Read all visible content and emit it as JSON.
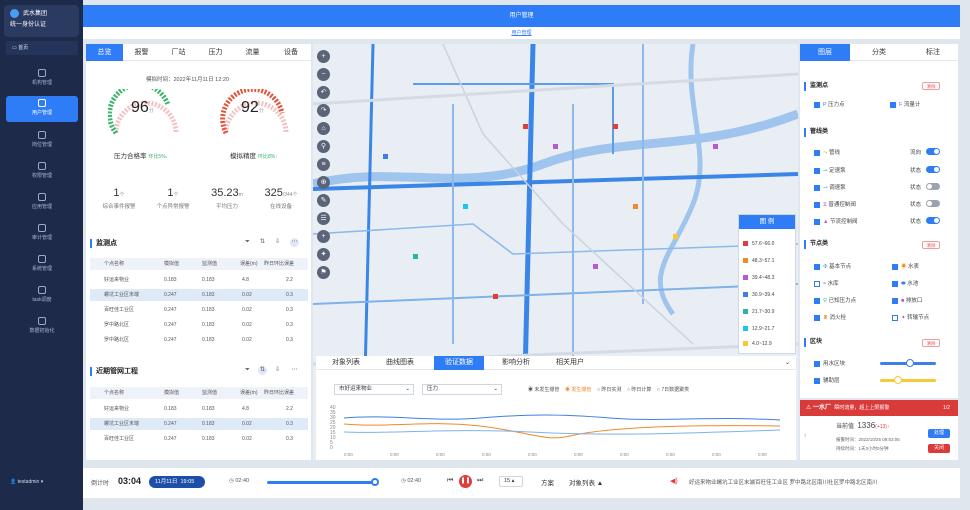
{
  "sidebar": {
    "brand_line1": "武水集团",
    "brand_line2": "统一身份认证",
    "home": "首页",
    "items": [
      {
        "label": "机构管理"
      },
      {
        "label": "用户管理"
      },
      {
        "label": "岗位管理"
      },
      {
        "label": "权限管理"
      },
      {
        "label": "应用管理"
      },
      {
        "label": "审计管理"
      },
      {
        "label": "系统管理"
      },
      {
        "label": "task调度"
      },
      {
        "label": "数据初始化"
      }
    ],
    "username": "testadmin"
  },
  "header": {
    "title": "用户管理",
    "breadcrumb": "用户管理"
  },
  "left_panel": {
    "tabs": [
      "总览",
      "报警",
      "厂站",
      "压力",
      "流量",
      "设备"
    ],
    "time_label": "模拟时间：2022年11月11日 12:20",
    "gauge1": {
      "value": "96",
      "unit": "分",
      "label": "压力合格率",
      "delta": "环比5%↓"
    },
    "gauge2": {
      "value": "92",
      "unit": "分",
      "label": "模拟精度",
      "delta": "环比8%↑"
    },
    "stats": [
      {
        "value": "1",
        "unit": "个",
        "label": "综合事件报警"
      },
      {
        "value": "1",
        "unit": "个",
        "label": "个点异常报警"
      },
      {
        "value": "35.23",
        "unit": "m",
        "label": "平均压力"
      },
      {
        "value": "325",
        "unit": "/344个",
        "label": "在线设备"
      }
    ],
    "monitor_title": "监测点",
    "monitor_headers": [
      "个点名称",
      "模拟值",
      "监测值",
      "误差(m)",
      "昨日环比误差"
    ],
    "monitor_rows": [
      [
        "好运来物业",
        "0.183",
        "0.183",
        "4.8",
        "2.2"
      ],
      [
        "螺坑工业区末端",
        "0.247",
        "0.183",
        "0.02",
        "0.3"
      ],
      [
        "百旺佳工业区",
        "0.247",
        "0.183",
        "0.02",
        "0.3"
      ],
      [
        "罗中路北区",
        "0.247",
        "0.183",
        "0.02",
        "0.3"
      ],
      [
        "罗中路北区",
        "0.247",
        "0.183",
        "0.02",
        "0.3"
      ]
    ],
    "project_title": "近期管网工程",
    "project_headers": [
      "个点名称",
      "模拟值",
      "监测值",
      "误差(m)",
      "昨日环比误差"
    ],
    "project_rows": [
      [
        "好运来物业",
        "0.183",
        "0.183",
        "4.8",
        "2.2"
      ],
      [
        "螺坑工业区末端",
        "0.247",
        "0.183",
        "0.02",
        "0.3"
      ],
      [
        "百旺佳工业区",
        "0.247",
        "0.183",
        "0.02",
        "0.3"
      ]
    ]
  },
  "bottom_panel": {
    "tabs": [
      "对象列表",
      "曲线图表",
      "验证数据",
      "影响分析",
      "相关用户"
    ],
    "select1": "市好运来物业",
    "select2": "压力",
    "radios": [
      "未发生爆管",
      "发生爆管",
      "昨日实测",
      "昨日计算",
      "7日数据聚类"
    ],
    "y_ticks": [
      "40",
      "35",
      "30",
      "25",
      "20",
      "15",
      "10",
      "5",
      "0"
    ],
    "x_tick": "0:00"
  },
  "right_panel": {
    "tabs": [
      "图层",
      "分类",
      "标注"
    ],
    "clear_label": "清除",
    "sec1": "监测点",
    "s1_items": [
      "压力点",
      "流量计"
    ],
    "sec2": "管线类",
    "s2_items": [
      "管线",
      "定速泵",
      "调速泵",
      "普通控制阀",
      "节流控制阀"
    ],
    "s2_right": [
      "流向",
      "状态",
      "状态",
      "状态",
      "状态"
    ],
    "sec3": "节点类",
    "s3_items": [
      "基本节点",
      "水表",
      "水库",
      "水池",
      "已知压力点",
      "排放口",
      "消火栓",
      "转输节点"
    ],
    "sec4": "区块",
    "s4_items": [
      "用水区块",
      "辅助层"
    ]
  },
  "legend": {
    "title": "图 例",
    "items": [
      {
        "label": "57.6~66.0",
        "color": "#e23b3b"
      },
      {
        "label": "48.3~57.1",
        "color": "#f0892c"
      },
      {
        "label": "39.4~48.3",
        "color": "#b45ad6"
      },
      {
        "label": "30.9~39.4",
        "color": "#3f7ee8"
      },
      {
        "label": "21.7~30.9",
        "color": "#2fb3a8"
      },
      {
        "label": "12.9~21.7",
        "color": "#19c6f0"
      },
      {
        "label": "4.0~12.9",
        "color": "#f7c933"
      }
    ]
  },
  "alert": {
    "title": "一水厂",
    "subtitle": "瞬时流量，超上上限报警",
    "page": "1/2",
    "current_label": "当前值",
    "current_value": "1336",
    "current_delta": "(+13)↑",
    "time1": "报警时间：2022/10/25 09:53:05",
    "time2": "持续时间：1天3小时0分钟",
    "btn1": "处理",
    "btn2": "关闭"
  },
  "footer": {
    "countdown_label": "倒计时",
    "countdown": "03:04",
    "date": "11月11日",
    "time": "19:05",
    "play_left": "02:40",
    "play_right": "02:40",
    "speed": "15",
    "btn_plan": "方案",
    "btn_list": "对象列表 ▲",
    "marquee": "好运来物业螺坑工业区末端百旺佳工业区 罗中路北区南川社区罗中路北区南川"
  },
  "colors": {
    "accent": "#2f7df6",
    "sidebar": "#1e2a4a",
    "alert": "#d93a3a"
  }
}
